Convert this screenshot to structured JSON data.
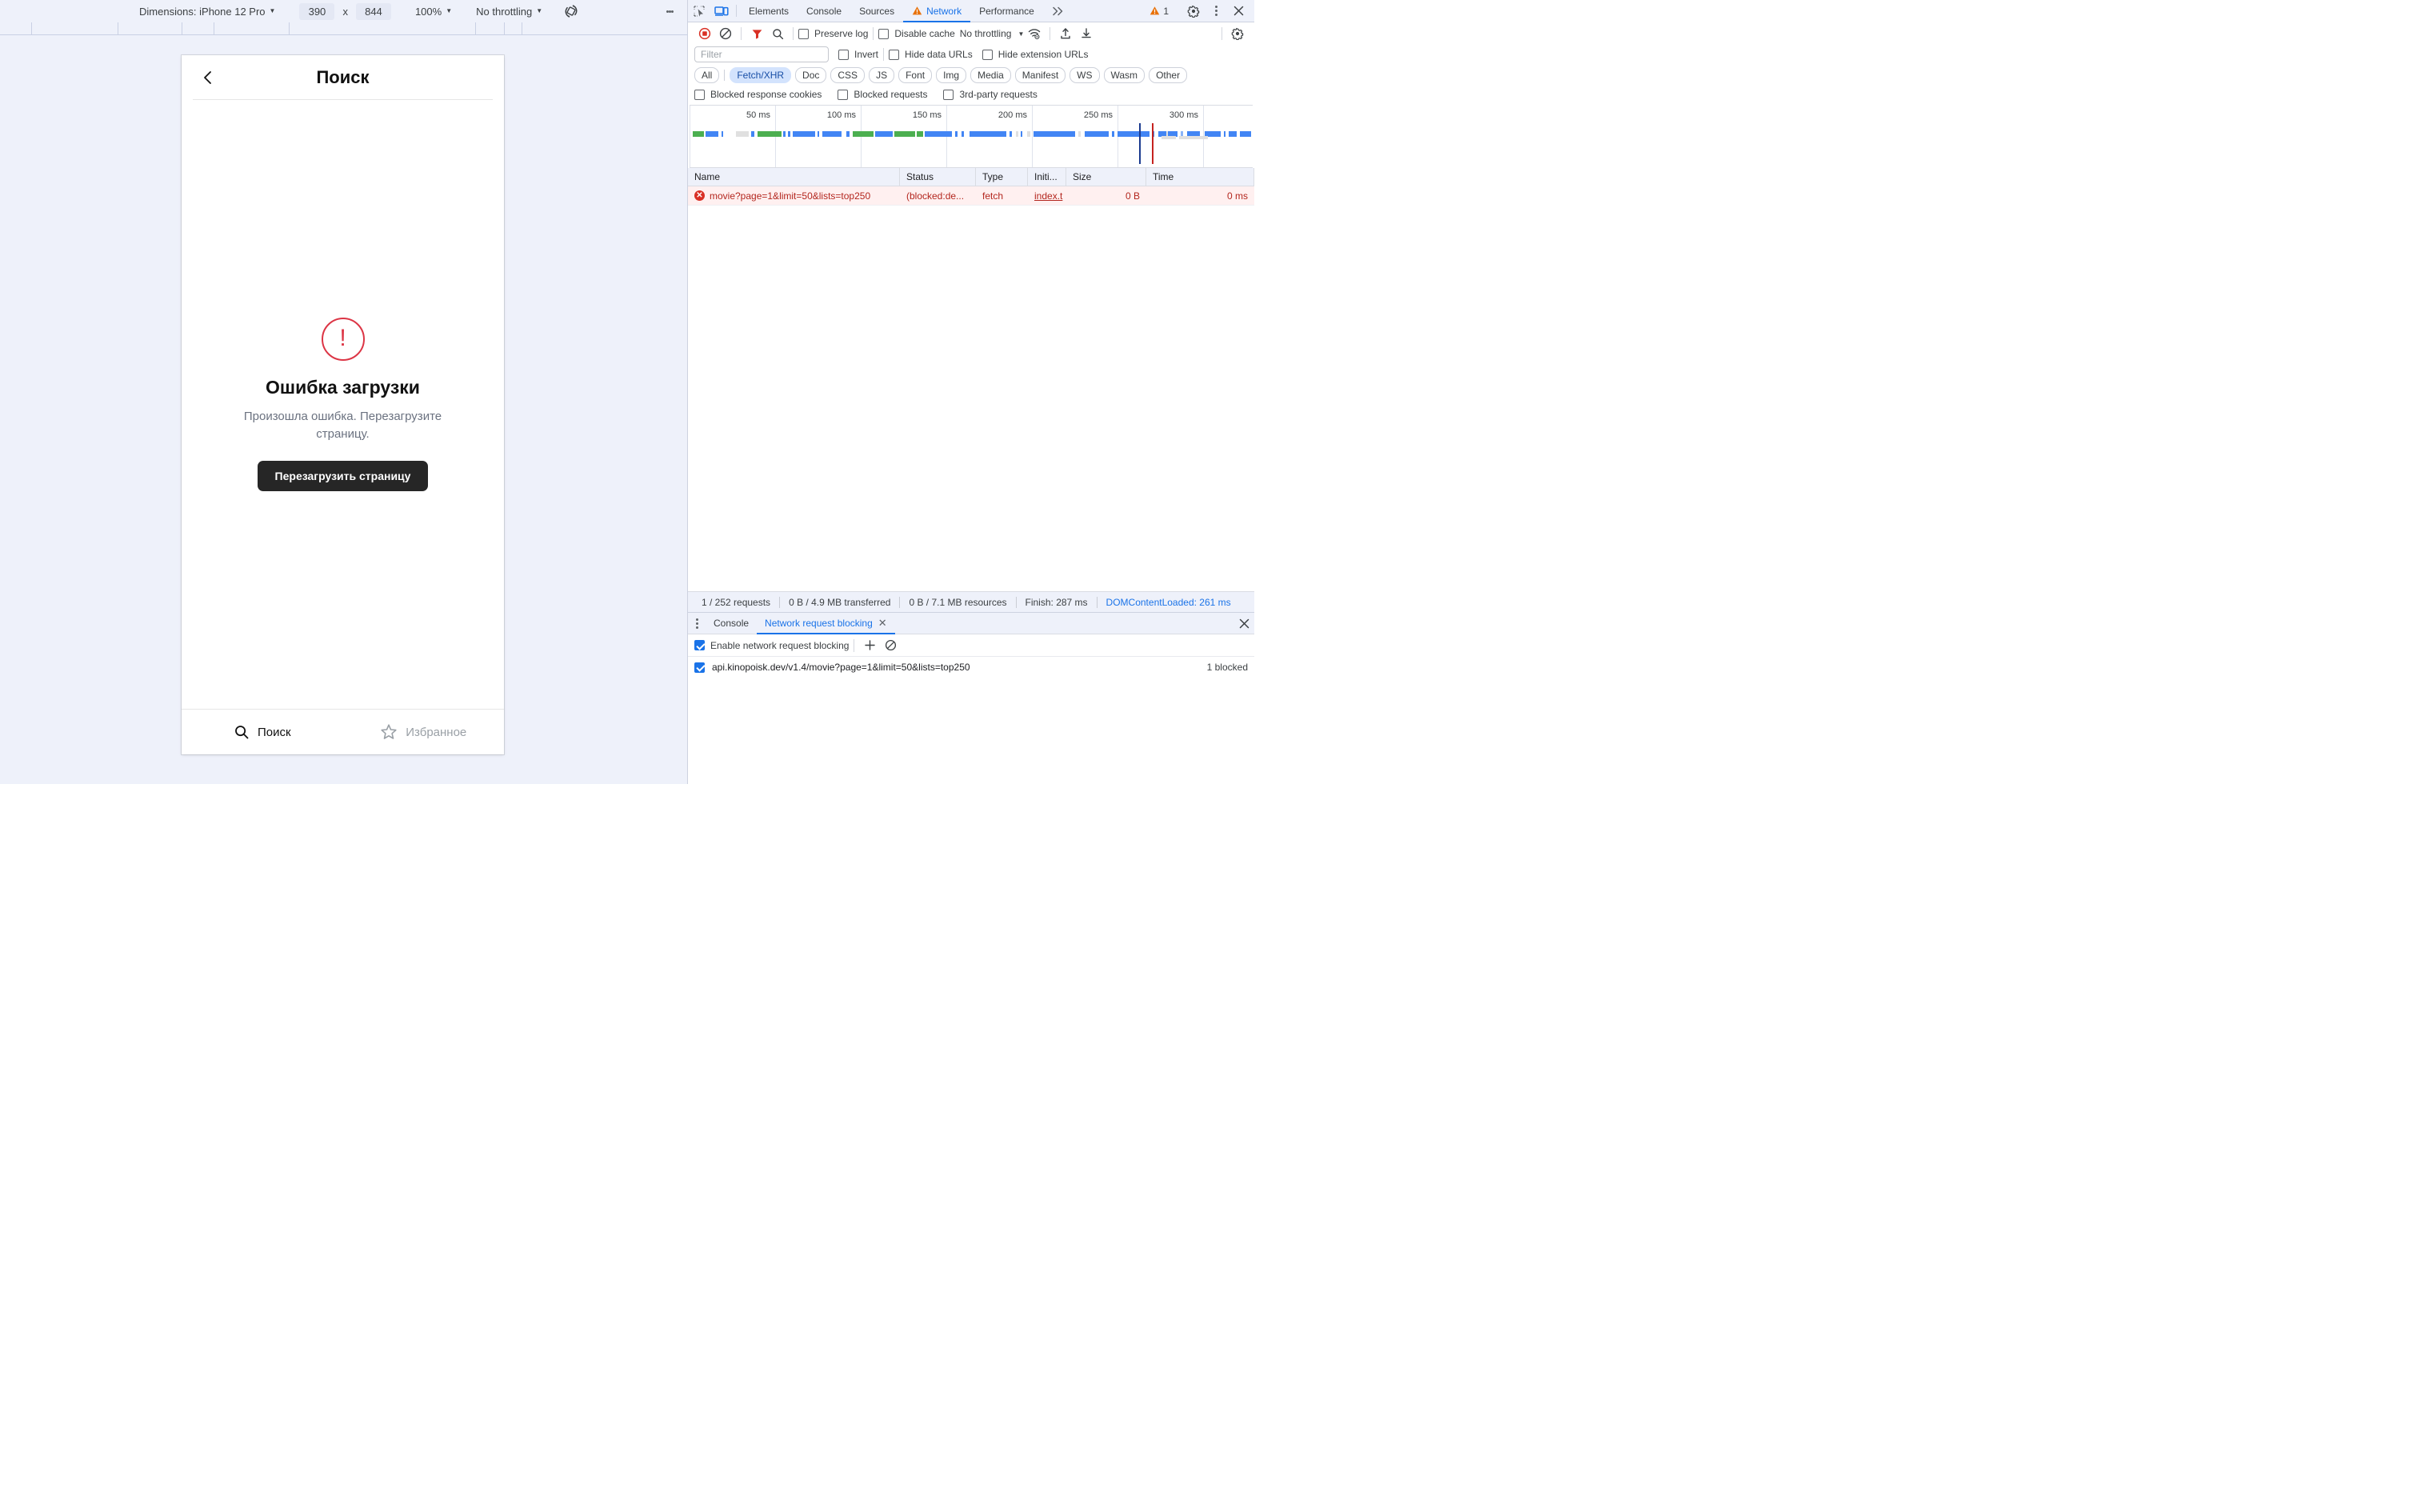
{
  "device_toolbar": {
    "dimensions_label": "Dimensions: iPhone 12 Pro",
    "width_value": "390",
    "x_symbol": "x",
    "height_value": "844",
    "zoom_label": "100%",
    "throttling_label": "No throttling",
    "rotate_icon": "rotate-device-icon",
    "more_icon": "kebab-menu-icon"
  },
  "phone": {
    "back_icon": "chevron-left-icon",
    "title": "Поиск",
    "error": {
      "icon": "error-circle-exclamation-icon",
      "title": "Ошибка загрузки",
      "subtitle": "Произошла ошибка. Перезагрузите страницу.",
      "button_label": "Перезагрузить страницу"
    },
    "tabbar": [
      {
        "icon": "search-icon",
        "label": "Поиск",
        "active": true
      },
      {
        "icon": "star-outline-icon",
        "label": "Избранное",
        "active": false
      }
    ]
  },
  "devtools": {
    "tabs": [
      {
        "label": "Elements",
        "active": false,
        "warn": false
      },
      {
        "label": "Console",
        "active": false,
        "warn": false
      },
      {
        "label": "Sources",
        "active": false,
        "warn": false
      },
      {
        "label": "Network",
        "active": true,
        "warn": true
      },
      {
        "label": "Performance",
        "active": false,
        "warn": false
      }
    ],
    "more_tabs_icon": "chevron-double-right-icon",
    "warning_count": "1",
    "settings_icon": "gear-icon",
    "kebab_icon": "kebab-menu-icon",
    "close_icon": "close-icon",
    "inspect_icon": "inspect-element-icon",
    "device_toggle_icon": "device-toolbar-icon",
    "network": {
      "record_icon": "record-stop-icon",
      "clear_icon": "clear-circle-slash-icon",
      "filter_icon": "funnel-filter-icon",
      "search_icon": "search-icon",
      "preserve_log": {
        "label": "Preserve log",
        "checked": false
      },
      "disable_cache": {
        "label": "Disable cache",
        "checked": false
      },
      "throttling": "No throttling",
      "wifi_icon": "network-conditions-icon",
      "import_icon": "upload-har-icon",
      "export_icon": "download-har-icon",
      "network_settings_icon": "gear-icon",
      "filter_placeholder": "Filter",
      "filter_value": "",
      "invert": {
        "label": "Invert",
        "checked": false
      },
      "hide_data_urls": {
        "label": "Hide data URLs",
        "checked": false
      },
      "hide_extension_urls": {
        "label": "Hide extension URLs",
        "checked": false
      },
      "type_chips": [
        {
          "label": "All",
          "selected": false
        },
        {
          "label": "Fetch/XHR",
          "selected": true
        },
        {
          "label": "Doc",
          "selected": false
        },
        {
          "label": "CSS",
          "selected": false
        },
        {
          "label": "JS",
          "selected": false
        },
        {
          "label": "Font",
          "selected": false
        },
        {
          "label": "Img",
          "selected": false
        },
        {
          "label": "Media",
          "selected": false
        },
        {
          "label": "Manifest",
          "selected": false
        },
        {
          "label": "WS",
          "selected": false
        },
        {
          "label": "Wasm",
          "selected": false
        },
        {
          "label": "Other",
          "selected": false
        }
      ],
      "blocked_response_cookies": {
        "label": "Blocked response cookies",
        "checked": false
      },
      "blocked_requests": {
        "label": "Blocked requests",
        "checked": false
      },
      "third_party_requests": {
        "label": "3rd-party requests",
        "checked": false
      },
      "overview_ticks": [
        "50 ms",
        "100 ms",
        "150 ms",
        "200 ms",
        "250 ms",
        "300 ms"
      ],
      "columns": [
        "Name",
        "Status",
        "Type",
        "Initi...",
        "Size",
        "Time"
      ],
      "rows": [
        {
          "name": "movie?page=1&limit=50&lists=top250",
          "status": "(blocked:de...",
          "type": "fetch",
          "initiator": "index.t",
          "size": "0 B",
          "time": "0 ms",
          "error": true
        }
      ],
      "summary": {
        "requests": "1 / 252 requests",
        "transferred": "0 B / 4.9 MB transferred",
        "resources": "0 B / 7.1 MB resources",
        "finish": "Finish: 287 ms",
        "dom_content_loaded": "DOMContentLoaded: 261 ms"
      }
    },
    "drawer": {
      "kebab_icon": "kebab-menu-icon",
      "tabs": [
        {
          "label": "Console",
          "active": false,
          "closable": false
        },
        {
          "label": "Network request blocking",
          "active": true,
          "closable": true
        }
      ],
      "close_icon": "close-icon",
      "enable_blocking": {
        "label": "Enable network request blocking",
        "checked": true
      },
      "add_icon": "plus-icon",
      "remove_all_icon": "clear-circle-slash-icon",
      "patterns": [
        {
          "checked": true,
          "url": "api.kinopoisk.dev/v1.4/movie?page=1&limit=50&lists=top250",
          "count": "1 blocked"
        }
      ]
    }
  }
}
